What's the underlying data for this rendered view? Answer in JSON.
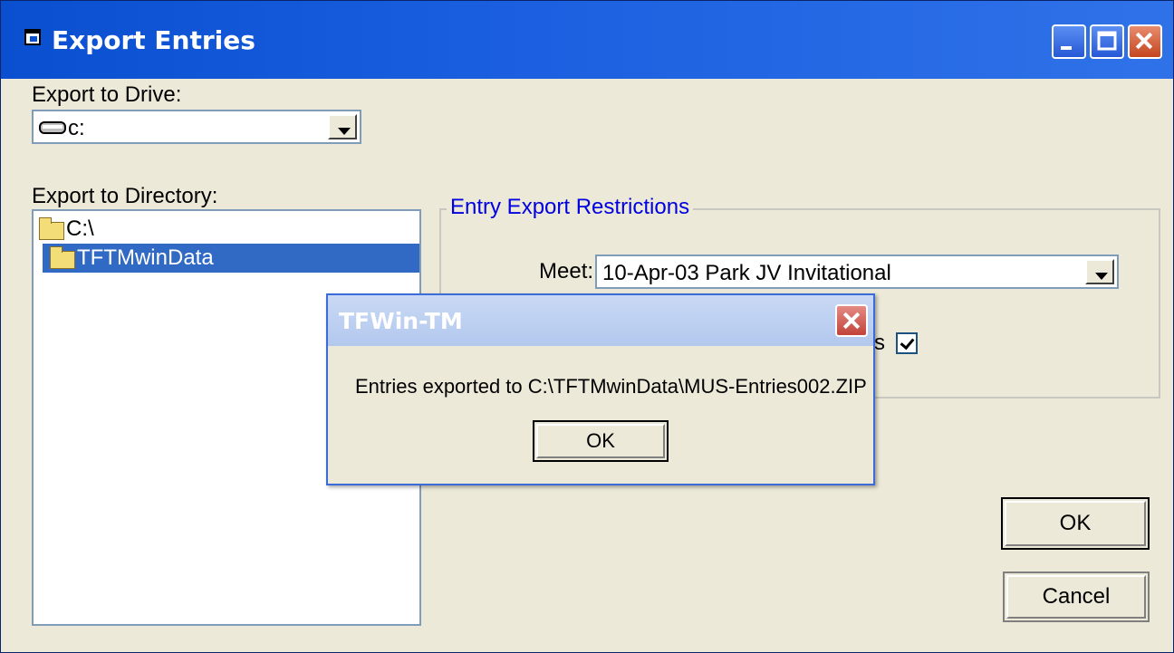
{
  "window": {
    "title": "Export Entries",
    "controls": [
      "minimize-icon",
      "maximize-icon",
      "close-icon"
    ]
  },
  "drive": {
    "label": "Export to Drive:",
    "value": "c:",
    "icon": "drive-icon"
  },
  "directory": {
    "label": "Export to Directory:",
    "items": [
      {
        "label": "C:\\",
        "icon": "open-folder-icon",
        "selected": false
      },
      {
        "label": "TFTMwinData",
        "icon": "open-folder-icon",
        "selected": true
      }
    ]
  },
  "restrictions": {
    "title": "Entry Export Restrictions",
    "meet_label": "Meet:",
    "meet_value": "10-Apr-03 Park JV Invitational",
    "checkbox_label_partial": "s",
    "checkbox_checked": true
  },
  "buttons": {
    "ok": "OK",
    "cancel": "Cancel"
  },
  "dialog": {
    "title": "TFWin-TM",
    "message": "Entries exported to C:\\TFTMwinData\\MUS-Entries002.ZIP",
    "ok": "OK"
  },
  "colors": {
    "title_bar": "#0a4fd0",
    "window_face": "#ece9d8",
    "selection": "#316ac5",
    "group_title": "#0000e0",
    "dialog_title": "#c9d9f5"
  }
}
